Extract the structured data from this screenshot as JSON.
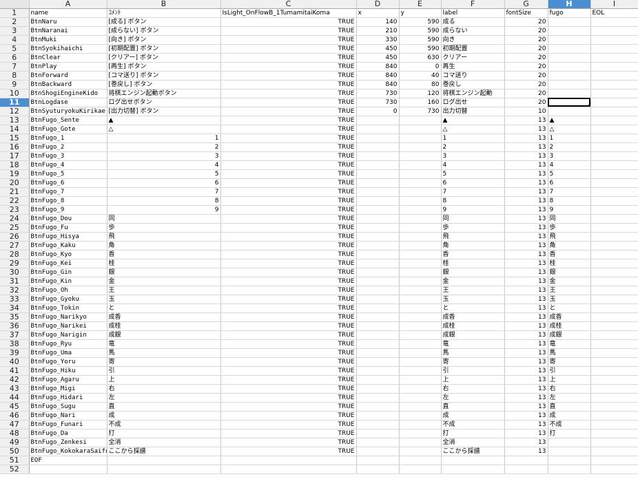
{
  "columns": [
    "A",
    "B",
    "C",
    "D",
    "E",
    "F",
    "G",
    "H",
    "I"
  ],
  "active_column": "H",
  "active_row": 11,
  "rows": [
    {
      "num": "1",
      "a": "name",
      "b": "ｺﾒﾝﾄ",
      "c": "IsLight_OnFlowB_1TumamitaiKoma",
      "d": "x",
      "e": "y",
      "f": "label",
      "g": "fontSize",
      "h": "fugo",
      "i": "EOL"
    },
    {
      "num": "2",
      "a": "BtnNaru",
      "b": "[成る] ボタン",
      "c": "TRUE",
      "d": "140",
      "e": "590",
      "f": "成る",
      "g": "20",
      "h": "",
      "i": ""
    },
    {
      "num": "3",
      "a": "BtnNaranai",
      "b": "[成らない] ボタン",
      "c": "TRUE",
      "d": "210",
      "e": "590",
      "f": "成らない",
      "g": "20",
      "h": "",
      "i": ""
    },
    {
      "num": "4",
      "a": "BtnMuki",
      "b": "[向き] ボタン",
      "c": "TRUE",
      "d": "330",
      "e": "590",
      "f": "向き",
      "g": "20",
      "h": "",
      "i": ""
    },
    {
      "num": "5",
      "a": "BtnSyokihaichi",
      "b": "[初期配置] ボタン",
      "c": "TRUE",
      "d": "450",
      "e": "590",
      "f": "初期配置",
      "g": "20",
      "h": "",
      "i": ""
    },
    {
      "num": "6",
      "a": "BtnClear",
      "b": "[クリアー] ボタン",
      "c": "TRUE",
      "d": "450",
      "e": "630",
      "f": "クリアー",
      "g": "20",
      "h": "",
      "i": ""
    },
    {
      "num": "7",
      "a": "BtnPlay",
      "b": "[再生] ボタン",
      "c": "TRUE",
      "d": "840",
      "e": "0",
      "f": "再生",
      "g": "20",
      "h": "",
      "i": ""
    },
    {
      "num": "8",
      "a": "BtnForward",
      "b": "[コマ送り] ボタン",
      "c": "TRUE",
      "d": "840",
      "e": "40",
      "f": "コマ送り",
      "g": "20",
      "h": "",
      "i": ""
    },
    {
      "num": "9",
      "a": "BtnBackward",
      "b": "[巻戻し] ボタン",
      "c": "TRUE",
      "d": "840",
      "e": "80",
      "f": "巻戻し",
      "g": "20",
      "h": "",
      "i": ""
    },
    {
      "num": "10",
      "a": "BtnShogiEngineKido",
      "b": "将棋エンジン起動ボタン",
      "c": "TRUE",
      "d": "730",
      "e": "120",
      "f": "将棋エンジン起動",
      "g": "20",
      "h": "",
      "i": ""
    },
    {
      "num": "11",
      "a": "BtnLogdase",
      "b": "ログ出せボタン",
      "c": "TRUE",
      "d": "730",
      "e": "160",
      "f": "ログ出せ",
      "g": "20",
      "h": "",
      "i": ""
    },
    {
      "num": "12",
      "a": "BtnSyuturyokuKirikae",
      "b": "[出力切替] ボタン",
      "c": "TRUE",
      "d": "0",
      "e": "730",
      "f": "出力切替",
      "g": "10",
      "h": "",
      "i": ""
    },
    {
      "num": "13",
      "a": "BtnFugo_Sente",
      "b": "▲",
      "c": "TRUE",
      "d": "",
      "e": "",
      "f": "▲",
      "g": "13",
      "h": "▲",
      "i": ""
    },
    {
      "num": "14",
      "a": "BtnFugo_Gote",
      "b": "△",
      "c": "TRUE",
      "d": "",
      "e": "",
      "f": "△",
      "g": "13",
      "h": "△",
      "i": ""
    },
    {
      "num": "15",
      "a": "BtnFugo_1",
      "b": "1",
      "c": "TRUE",
      "d": "",
      "e": "",
      "f": "1",
      "g": "13",
      "h": "1",
      "i": ""
    },
    {
      "num": "16",
      "a": "BtnFugo_2",
      "b": "2",
      "c": "TRUE",
      "d": "",
      "e": "",
      "f": "2",
      "g": "13",
      "h": "2",
      "i": ""
    },
    {
      "num": "17",
      "a": "BtnFugo_3",
      "b": "3",
      "c": "TRUE",
      "d": "",
      "e": "",
      "f": "3",
      "g": "13",
      "h": "3",
      "i": ""
    },
    {
      "num": "18",
      "a": "BtnFugo_4",
      "b": "4",
      "c": "TRUE",
      "d": "",
      "e": "",
      "f": "4",
      "g": "13",
      "h": "4",
      "i": ""
    },
    {
      "num": "19",
      "a": "BtnFugo_5",
      "b": "5",
      "c": "TRUE",
      "d": "",
      "e": "",
      "f": "5",
      "g": "13",
      "h": "5",
      "i": ""
    },
    {
      "num": "20",
      "a": "BtnFugo_6",
      "b": "6",
      "c": "TRUE",
      "d": "",
      "e": "",
      "f": "6",
      "g": "13",
      "h": "6",
      "i": ""
    },
    {
      "num": "21",
      "a": "BtnFugo_7",
      "b": "7",
      "c": "TRUE",
      "d": "",
      "e": "",
      "f": "7",
      "g": "13",
      "h": "7",
      "i": ""
    },
    {
      "num": "22",
      "a": "BtnFugo_8",
      "b": "8",
      "c": "TRUE",
      "d": "",
      "e": "",
      "f": "8",
      "g": "13",
      "h": "8",
      "i": ""
    },
    {
      "num": "23",
      "a": "BtnFugo_9",
      "b": "9",
      "c": "TRUE",
      "d": "",
      "e": "",
      "f": "9",
      "g": "13",
      "h": "9",
      "i": ""
    },
    {
      "num": "24",
      "a": "BtnFugo_Dou",
      "b": "同",
      "c": "TRUE",
      "d": "",
      "e": "",
      "f": "同",
      "g": "13",
      "h": "同",
      "i": ""
    },
    {
      "num": "25",
      "a": "BtnFugo_Fu",
      "b": "歩",
      "c": "TRUE",
      "d": "",
      "e": "",
      "f": "歩",
      "g": "13",
      "h": "歩",
      "i": ""
    },
    {
      "num": "26",
      "a": "BtnFugo_Hisya",
      "b": "飛",
      "c": "TRUE",
      "d": "",
      "e": "",
      "f": "飛",
      "g": "13",
      "h": "飛",
      "i": ""
    },
    {
      "num": "27",
      "a": "BtnFugo_Kaku",
      "b": "角",
      "c": "TRUE",
      "d": "",
      "e": "",
      "f": "角",
      "g": "13",
      "h": "角",
      "i": ""
    },
    {
      "num": "28",
      "a": "BtnFugo_Kyo",
      "b": "香",
      "c": "TRUE",
      "d": "",
      "e": "",
      "f": "香",
      "g": "13",
      "h": "香",
      "i": ""
    },
    {
      "num": "29",
      "a": "BtnFugo_Kei",
      "b": "桂",
      "c": "TRUE",
      "d": "",
      "e": "",
      "f": "桂",
      "g": "13",
      "h": "桂",
      "i": ""
    },
    {
      "num": "30",
      "a": "BtnFugo_Gin",
      "b": "銀",
      "c": "TRUE",
      "d": "",
      "e": "",
      "f": "銀",
      "g": "13",
      "h": "銀",
      "i": ""
    },
    {
      "num": "31",
      "a": "BtnFugo_Kin",
      "b": "金",
      "c": "TRUE",
      "d": "",
      "e": "",
      "f": "金",
      "g": "13",
      "h": "金",
      "i": ""
    },
    {
      "num": "32",
      "a": "BtnFugo_Oh",
      "b": "王",
      "c": "TRUE",
      "d": "",
      "e": "",
      "f": "王",
      "g": "13",
      "h": "王",
      "i": ""
    },
    {
      "num": "33",
      "a": "BtnFugo_Gyoku",
      "b": "玉",
      "c": "TRUE",
      "d": "",
      "e": "",
      "f": "玉",
      "g": "13",
      "h": "玉",
      "i": ""
    },
    {
      "num": "34",
      "a": "BtnFugo_Tokin",
      "b": "と",
      "c": "TRUE",
      "d": "",
      "e": "",
      "f": "と",
      "g": "13",
      "h": "と",
      "i": ""
    },
    {
      "num": "35",
      "a": "BtnFugo_Narikyo",
      "b": "成香",
      "c": "TRUE",
      "d": "",
      "e": "",
      "f": "成香",
      "g": "13",
      "h": "成香",
      "i": ""
    },
    {
      "num": "36",
      "a": "BtnFugo_Narikei",
      "b": "成桂",
      "c": "TRUE",
      "d": "",
      "e": "",
      "f": "成桂",
      "g": "13",
      "h": "成桂",
      "i": ""
    },
    {
      "num": "37",
      "a": "BtnFugo_Narigin",
      "b": "成銀",
      "c": "TRUE",
      "d": "",
      "e": "",
      "f": "成銀",
      "g": "13",
      "h": "成銀",
      "i": ""
    },
    {
      "num": "38",
      "a": "BtnFugo_Ryu",
      "b": "竜",
      "c": "TRUE",
      "d": "",
      "e": "",
      "f": "竜",
      "g": "13",
      "h": "竜",
      "i": ""
    },
    {
      "num": "39",
      "a": "BtnFugo_Uma",
      "b": "馬",
      "c": "TRUE",
      "d": "",
      "e": "",
      "f": "馬",
      "g": "13",
      "h": "馬",
      "i": ""
    },
    {
      "num": "40",
      "a": "BtnFugo_Yoru",
      "b": "寄",
      "c": "TRUE",
      "d": "",
      "e": "",
      "f": "寄",
      "g": "13",
      "h": "寄",
      "i": ""
    },
    {
      "num": "41",
      "a": "BtnFugo_Hiku",
      "b": "引",
      "c": "TRUE",
      "d": "",
      "e": "",
      "f": "引",
      "g": "13",
      "h": "引",
      "i": ""
    },
    {
      "num": "42",
      "a": "BtnFugo_Agaru",
      "b": "上",
      "c": "TRUE",
      "d": "",
      "e": "",
      "f": "上",
      "g": "13",
      "h": "上",
      "i": ""
    },
    {
      "num": "43",
      "a": "BtnFugo_Migi",
      "b": "右",
      "c": "TRUE",
      "d": "",
      "e": "",
      "f": "右",
      "g": "13",
      "h": "右",
      "i": ""
    },
    {
      "num": "44",
      "a": "BtnFugo_Hidari",
      "b": "左",
      "c": "TRUE",
      "d": "",
      "e": "",
      "f": "左",
      "g": "13",
      "h": "左",
      "i": ""
    },
    {
      "num": "45",
      "a": "BtnFugo_Sugu",
      "b": "直",
      "c": "TRUE",
      "d": "",
      "e": "",
      "f": "直",
      "g": "13",
      "h": "直",
      "i": ""
    },
    {
      "num": "46",
      "a": "BtnFugo_Nari",
      "b": "成",
      "c": "TRUE",
      "d": "",
      "e": "",
      "f": "成",
      "g": "13",
      "h": "成",
      "i": ""
    },
    {
      "num": "47",
      "a": "BtnFugo_Funari",
      "b": "不成",
      "c": "TRUE",
      "d": "",
      "e": "",
      "f": "不成",
      "g": "13",
      "h": "不成",
      "i": ""
    },
    {
      "num": "48",
      "a": "BtnFugo_Da",
      "b": "打",
      "c": "TRUE",
      "d": "",
      "e": "",
      "f": "打",
      "g": "13",
      "h": "打",
      "i": ""
    },
    {
      "num": "49",
      "a": "BtnFugo_Zenkesi",
      "b": "全消",
      "c": "TRUE",
      "d": "",
      "e": "",
      "f": "全消",
      "g": "13",
      "h": "",
      "i": ""
    },
    {
      "num": "50",
      "a": "BtnFugo_KokokaraSaifu",
      "b": "ここから採譜",
      "c": "TRUE",
      "d": "",
      "e": "",
      "f": "ここから採譜",
      "g": "13",
      "h": "",
      "i": ""
    },
    {
      "num": "51",
      "a": "EOF",
      "b": "",
      "c": "",
      "d": "",
      "e": "",
      "f": "",
      "g": "",
      "h": "",
      "i": ""
    },
    {
      "num": "52",
      "a": "",
      "b": "",
      "c": "",
      "d": "",
      "e": "",
      "f": "",
      "g": "",
      "h": "",
      "i": ""
    }
  ]
}
